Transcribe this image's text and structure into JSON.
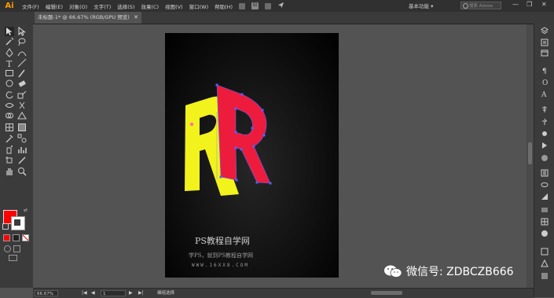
{
  "app": {
    "logo": "Ai"
  },
  "menu": [
    "文件(F)",
    "编辑(E)",
    "对象(O)",
    "文字(T)",
    "选择(S)",
    "效果(C)",
    "视图(V)",
    "窗口(W)",
    "帮助(H)"
  ],
  "menubar_icons": {
    "st_label": "St"
  },
  "workspace": {
    "label": "基本功能 ▾"
  },
  "search": {
    "placeholder": "搜索 Adobe Stock"
  },
  "window_controls": {
    "minimize": "—",
    "maximize": "❐",
    "close": "✕"
  },
  "document_tab": {
    "title": "未标题-1* @ 66.67% (RGB/GPU 预览)",
    "close": "✕"
  },
  "colors": {
    "fill": "#ff0000",
    "stroke": "#ffffff",
    "yellow_r": "#f2f21c",
    "red_r": "#ee1c3c",
    "accent_selection": "#4f63ff"
  },
  "status_bar": {
    "zoom": "66.67%",
    "page": "1",
    "status_text": "编组选择",
    "nav_first": "|◀",
    "nav_prev": "◀",
    "nav_next": "▶",
    "nav_last": "▶|"
  },
  "watermark": {
    "title": "PS教程自学网",
    "subtitle": "学PS，就到PS教程自学网",
    "url": "WWW.16XX8.COM"
  },
  "wechat": {
    "text": "微信号: ZDBCZB666"
  },
  "artwork": {
    "letter": "R"
  }
}
